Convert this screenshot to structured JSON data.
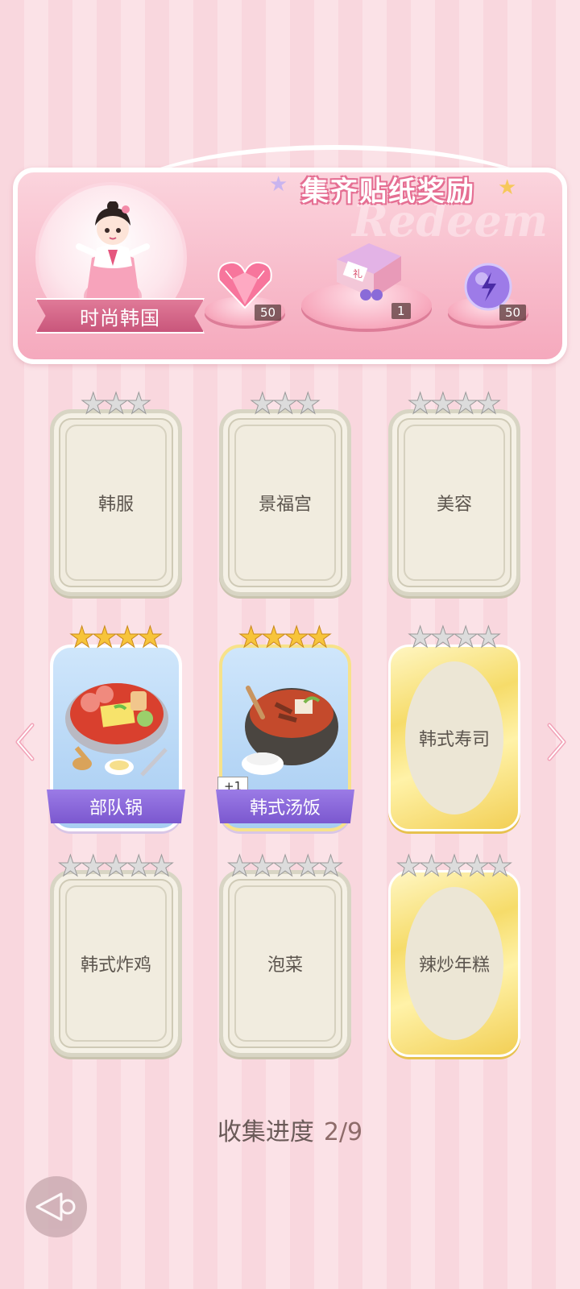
{
  "banner": {
    "title": "集齐贴纸奖励",
    "watermark": "Redeem",
    "region": "时尚韩国",
    "rewards": [
      {
        "icon": "pink-heart-gem-icon",
        "count": "50"
      },
      {
        "icon": "gift-box-icon",
        "count": "1"
      },
      {
        "icon": "purple-energy-orb-icon",
        "count": "50"
      }
    ]
  },
  "cards": [
    {
      "label": "韩服",
      "stars": 3,
      "style": "plain",
      "collected": false
    },
    {
      "label": "景福宫",
      "stars": 3,
      "style": "plain",
      "collected": false
    },
    {
      "label": "美容",
      "stars": 4,
      "style": "plain",
      "collected": false
    },
    {
      "label": "部队锅",
      "stars": 4,
      "style": "collected",
      "collected": true
    },
    {
      "label": "韩式汤饭",
      "stars": 4,
      "style": "collected",
      "collected": true,
      "extra": "+1"
    },
    {
      "label": "韩式寿司",
      "stars": 4,
      "style": "gold",
      "collected": false
    },
    {
      "label": "韩式炸鸡",
      "stars": 5,
      "style": "plain",
      "collected": false
    },
    {
      "label": "泡菜",
      "stars": 5,
      "style": "plain",
      "collected": false
    },
    {
      "label": "辣炒年糕",
      "stars": 5,
      "style": "gold",
      "collected": false
    }
  ],
  "progress": {
    "label": "收集进度",
    "value": "2/9"
  },
  "colors": {
    "accent": "#e56f93",
    "ribbon": "#8a68da",
    "gold": "#f6dc6a"
  }
}
